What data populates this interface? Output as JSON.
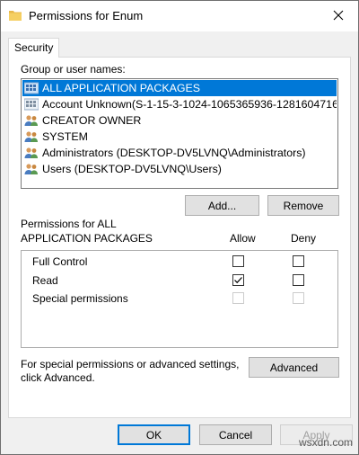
{
  "window": {
    "title": "Permissions for Enum"
  },
  "tabs": [
    {
      "label": "Security"
    }
  ],
  "group_label": "Group or user names:",
  "users": [
    {
      "name": "ALL APPLICATION PACKAGES",
      "icon": "app-packages-icon",
      "selected": true
    },
    {
      "name": "Account Unknown(S-1-15-3-1024-1065365936-1281604716...",
      "icon": "unknown-account-icon",
      "selected": false
    },
    {
      "name": "CREATOR OWNER",
      "icon": "users-group-icon",
      "selected": false
    },
    {
      "name": "SYSTEM",
      "icon": "users-group-icon",
      "selected": false
    },
    {
      "name": "Administrators (DESKTOP-DV5LVNQ\\Administrators)",
      "icon": "users-group-icon",
      "selected": false
    },
    {
      "name": "Users (DESKTOP-DV5LVNQ\\Users)",
      "icon": "users-group-icon",
      "selected": false
    }
  ],
  "buttons": {
    "add": "Add...",
    "remove": "Remove",
    "advanced": "Advanced",
    "ok": "OK",
    "cancel": "Cancel",
    "apply": "Apply"
  },
  "permissions": {
    "header_line1": "Permissions for ALL",
    "header_line2": "APPLICATION PACKAGES",
    "allow_label": "Allow",
    "deny_label": "Deny",
    "rows": [
      {
        "name": "Full Control",
        "allow": false,
        "deny": false,
        "disabled": false
      },
      {
        "name": "Read",
        "allow": true,
        "deny": false,
        "disabled": false
      },
      {
        "name": "Special permissions",
        "allow": false,
        "deny": false,
        "disabled": true
      }
    ]
  },
  "advanced_text_line1": "For special permissions or advanced settings,",
  "advanced_text_line2": "click Advanced.",
  "watermark": "wsxdn.com"
}
